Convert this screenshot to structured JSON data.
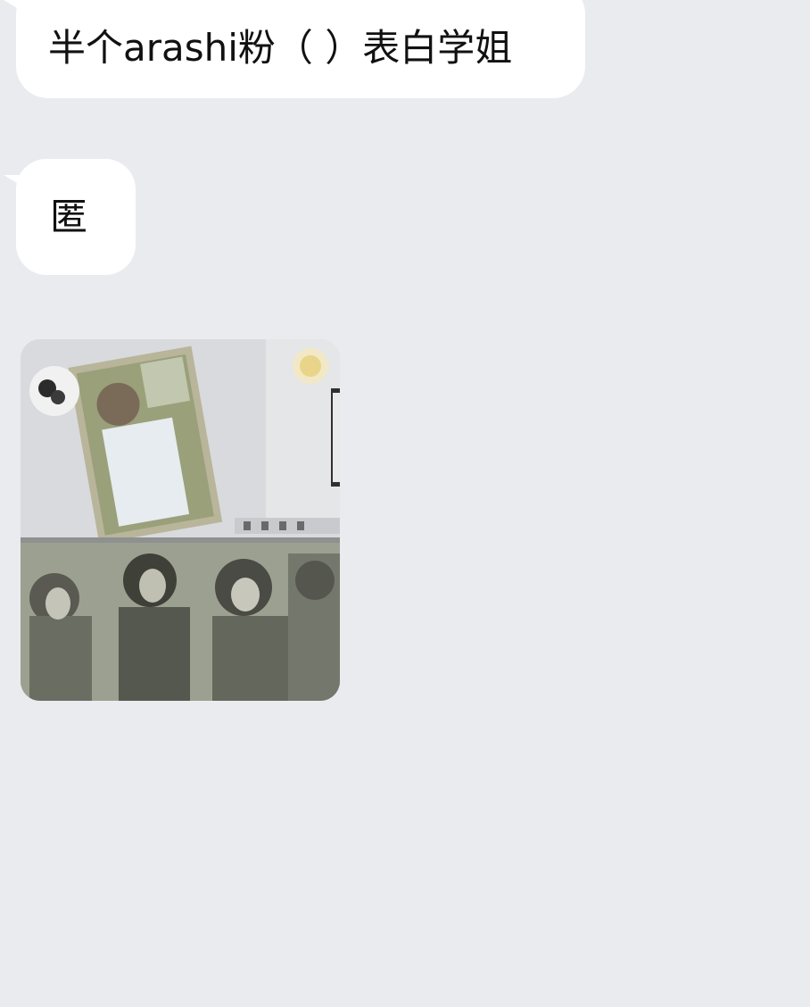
{
  "chat": {
    "messages": [
      {
        "type": "text",
        "text": "半个arashi粉（ ）表白学姐"
      },
      {
        "type": "text",
        "text": "匿"
      },
      {
        "type": "image",
        "description_icon": "photo-icon"
      }
    ]
  },
  "colors": {
    "background": "#eaebef",
    "bubble": "#ffffff",
    "text": "#111111"
  }
}
